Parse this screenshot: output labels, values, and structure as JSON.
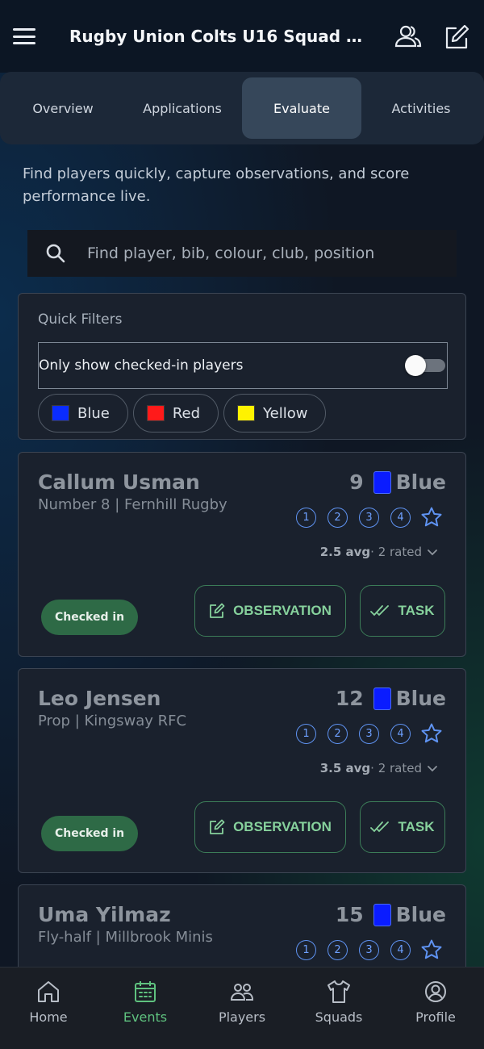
{
  "app_bar": {
    "title": "Rugby Union Colts U16 Squad Tri…",
    "icons": [
      "menu-icon",
      "group-icon",
      "edit-icon"
    ]
  },
  "tabs": [
    {
      "label": "Overview",
      "active": false
    },
    {
      "label": "Applications",
      "active": false
    },
    {
      "label": "Evaluate",
      "active": true
    },
    {
      "label": "Activities",
      "active": false
    }
  ],
  "intro": "Find players quickly, capture observations, and score performance live.",
  "search": {
    "placeholder": "Find player, bib, colour, club, position",
    "value": ""
  },
  "quick_filters": {
    "heading": "Quick Filters",
    "checked_in_label": "Only show checked-in players",
    "checked_in_enabled": false,
    "colour_chips": [
      {
        "label": "Blue",
        "color": "#0a2cff"
      },
      {
        "label": "Red",
        "color": "#ff1a1a"
      },
      {
        "label": "Yellow",
        "color": "#fff200"
      }
    ]
  },
  "players": [
    {
      "name": "Callum Usman",
      "position_club": "Number 8 | Fernhill Rugby",
      "bib": "9",
      "bib_colour": "Blue",
      "bib_hex": "#0a1cff",
      "ratings": [
        "1",
        "2",
        "3",
        "4"
      ],
      "avg": "2.5 avg",
      "rated": " · 2 rated",
      "status": "Checked in",
      "observation_label": "OBSERVATION",
      "task_label": "TASK"
    },
    {
      "name": "Leo Jensen",
      "position_club": "Prop | Kingsway RFC",
      "bib": "12",
      "bib_colour": "Blue",
      "bib_hex": "#0a1cff",
      "ratings": [
        "1",
        "2",
        "3",
        "4"
      ],
      "avg": "3.5 avg",
      "rated": " · 2 rated",
      "status": "Checked in",
      "observation_label": "OBSERVATION",
      "task_label": "TASK"
    },
    {
      "name": "Uma Yilmaz",
      "position_club": "Fly-half | Millbrook Minis",
      "bib": "15",
      "bib_colour": "Blue",
      "bib_hex": "#0a1cff",
      "ratings": [
        "1",
        "2",
        "3",
        "4"
      ]
    }
  ],
  "bottom_nav": [
    {
      "label": "Home",
      "icon": "home-icon",
      "active": false
    },
    {
      "label": "Events",
      "icon": "calendar-icon",
      "active": true
    },
    {
      "label": "Players",
      "icon": "players-icon",
      "active": false
    },
    {
      "label": "Squads",
      "icon": "shirt-icon",
      "active": false
    },
    {
      "label": "Profile",
      "icon": "profile-icon",
      "active": false
    }
  ],
  "colors": {
    "accent_green": "#5fc27f",
    "rating_blue": "#6ea0ff",
    "checked_in_bg": "#2e6a46"
  }
}
